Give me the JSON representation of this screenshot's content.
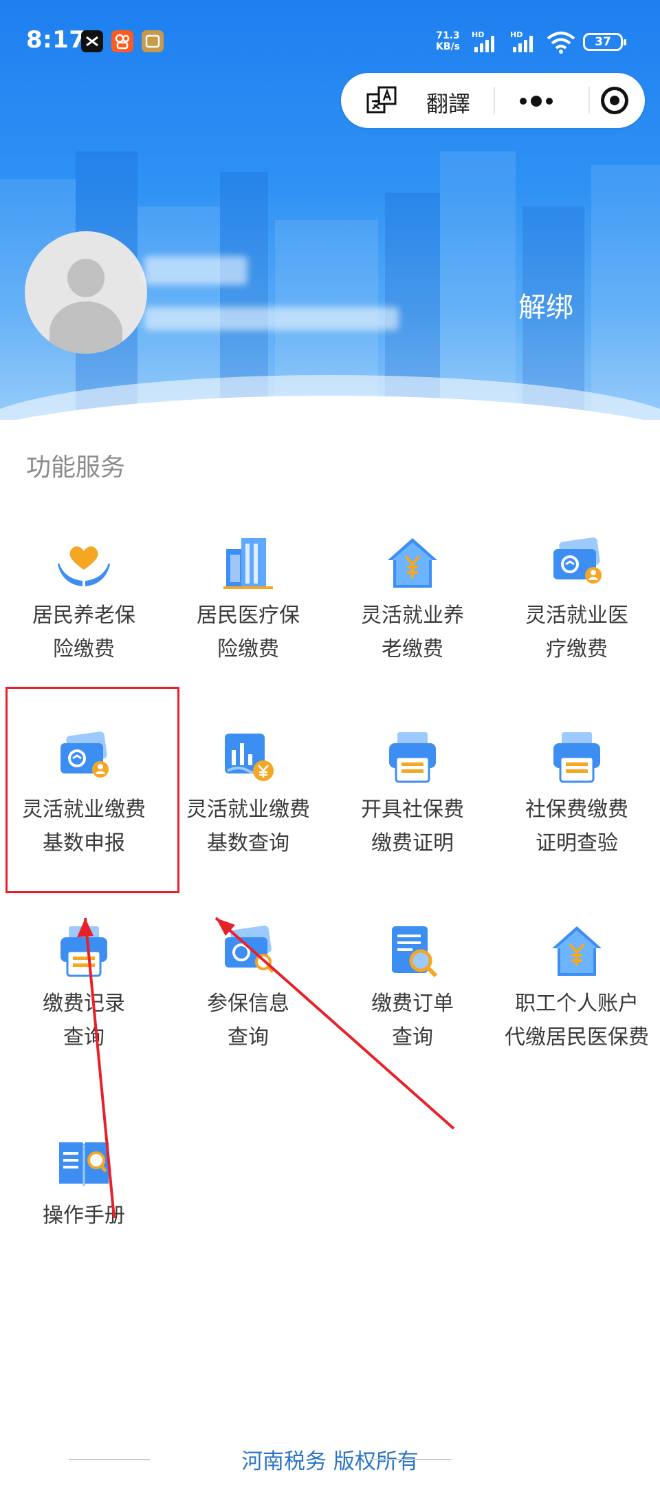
{
  "status_bar": {
    "time": "8:17",
    "net_speed_value": "71.3",
    "net_speed_unit": "KB/s",
    "hd1": "HD",
    "hd2": "HD",
    "battery": "37"
  },
  "capsule": {
    "translate_label": "翻譯"
  },
  "user": {
    "unbind_label": "解绑"
  },
  "section": {
    "title": "功能服务"
  },
  "services": [
    {
      "label": "居民养老保\n险缴费",
      "icon": "heart-hands-icon"
    },
    {
      "label": "居民医疗保\n险缴费",
      "icon": "hospital-building-icon"
    },
    {
      "label": "灵活就业养\n老缴费",
      "icon": "house-yuan-icon"
    },
    {
      "label": "灵活就业医\n疗缴费",
      "icon": "social-card-person-icon"
    },
    {
      "label": "灵活就业缴费\n基数申报",
      "icon": "social-card-person-icon"
    },
    {
      "label": "灵活就业缴费\n基数查询",
      "icon": "chart-yuan-icon"
    },
    {
      "label": "开具社保费\n缴费证明",
      "icon": "printer-icon"
    },
    {
      "label": "社保费缴费\n证明查验",
      "icon": "printer-icon"
    },
    {
      "label": "缴费记录\n查询",
      "icon": "printer-icon"
    },
    {
      "label": "参保信息\n查询",
      "icon": "social-card-search-icon"
    },
    {
      "label": "缴费订单\n查询",
      "icon": "document-search-icon"
    },
    {
      "label": "职工个人账户\n代缴居民医保费",
      "icon": "house-yuan-icon"
    },
    {
      "label": "操作手册",
      "icon": "manual-book-icon"
    }
  ],
  "footer": {
    "text": "河南税务 版权所有"
  },
  "colors": {
    "header_blue": "#1e7ff0",
    "icon_blue": "#3d8ef2",
    "icon_orange": "#f5a623",
    "highlight_red": "#e8202a",
    "footer_link": "#2a74c9"
  }
}
